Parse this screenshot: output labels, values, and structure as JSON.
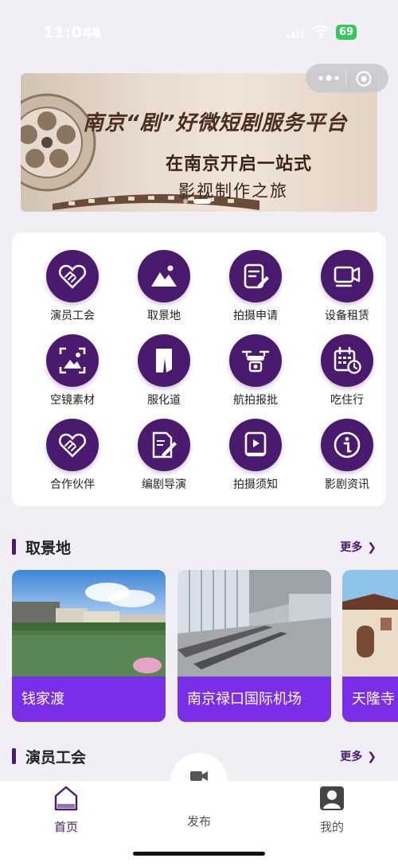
{
  "status_bar": {
    "time": "11:04",
    "battery": "69"
  },
  "banner": {
    "title": "南京“剧”好微短剧服务平台",
    "line2": "在南京开启一站式",
    "line3": "影视制作之旅"
  },
  "services": [
    {
      "label": "演员工会",
      "icon": "handshake-heart-icon"
    },
    {
      "label": "取景地",
      "icon": "mountain-picture-icon"
    },
    {
      "label": "拍摄申请",
      "icon": "edit-document-icon"
    },
    {
      "label": "设备租赁",
      "icon": "video-camera-icon"
    },
    {
      "label": "空镜素材",
      "icon": "image-frame-icon"
    },
    {
      "label": "服化道",
      "icon": "costume-icon"
    },
    {
      "label": "航拍报批",
      "icon": "drone-icon"
    },
    {
      "label": "吃住行",
      "icon": "calendar-clock-icon"
    },
    {
      "label": "合作伙伴",
      "icon": "handshake-heart-icon"
    },
    {
      "label": "编剧导演",
      "icon": "script-pen-icon"
    },
    {
      "label": "拍摄须知",
      "icon": "play-book-icon"
    },
    {
      "label": "影剧资讯",
      "icon": "info-icon"
    }
  ],
  "locations_section": {
    "title": "取景地",
    "more": "更多"
  },
  "locations": [
    {
      "name": "钱家渡"
    },
    {
      "name": "南京禄口国际机场"
    },
    {
      "name": "天隆寺"
    }
  ],
  "actors_section": {
    "title": "演员工会",
    "more": "更多"
  },
  "tab_bar": {
    "home": "首页",
    "publish": "发布",
    "mine": "我的"
  },
  "colors": {
    "brand_purple": "#4a1a6e",
    "card_purple": "#7b2ee8",
    "active_tab": "#4a1a6e"
  }
}
